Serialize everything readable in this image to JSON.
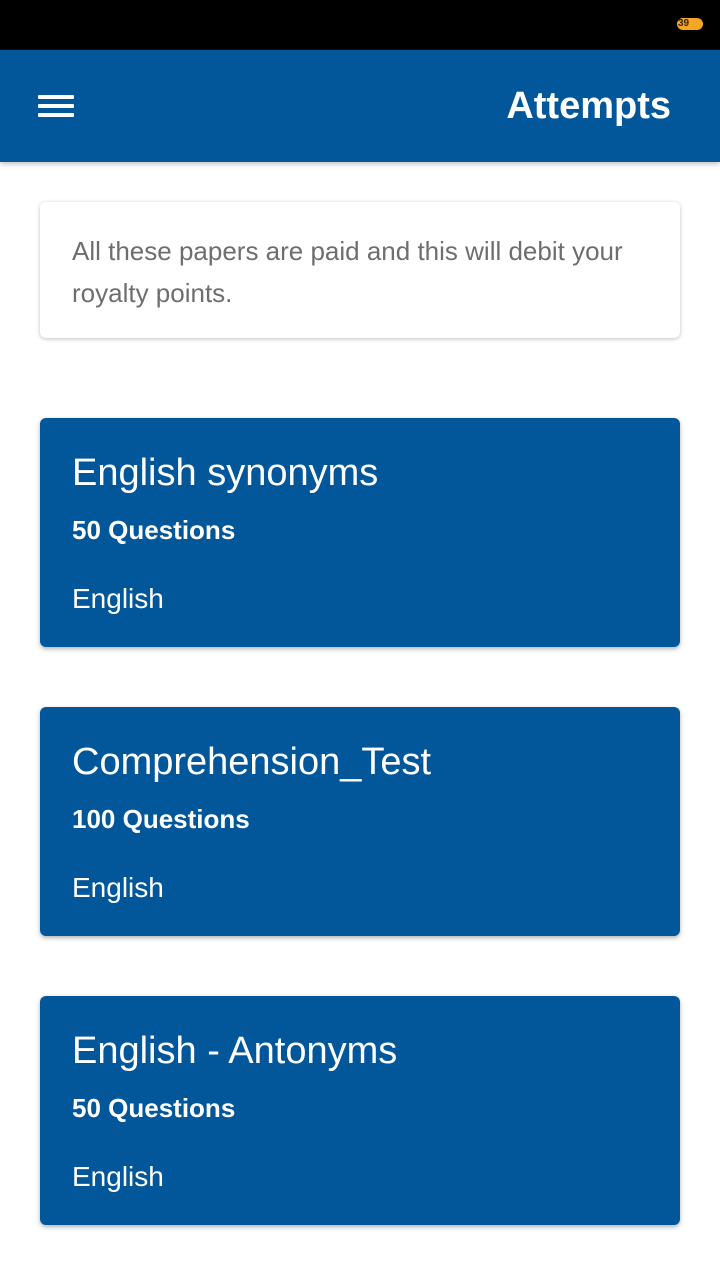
{
  "status_bar": {
    "battery_level": "39"
  },
  "app_bar": {
    "title": "Attempts",
    "menu_icon": "hamburger-menu-icon"
  },
  "notice": {
    "text": "All these papers are paid and this will debit your royalty points."
  },
  "papers": [
    {
      "title": "English synonyms",
      "questions": "50 Questions",
      "subject": "English"
    },
    {
      "title": "Comprehension_Test",
      "questions": "100 Questions",
      "subject": "English"
    },
    {
      "title": "English - Antonyms",
      "questions": "50 Questions",
      "subject": "English"
    }
  ],
  "colors": {
    "primary": "#02579b",
    "status_bar": "#000000",
    "battery": "#f5a623",
    "notice_text": "#6e6e6e"
  }
}
